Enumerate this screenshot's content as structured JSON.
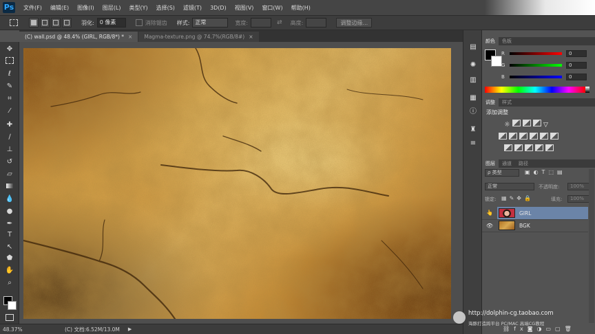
{
  "app": {
    "logo": "Ps"
  },
  "menu": [
    "文件(F)",
    "编辑(E)",
    "图像(I)",
    "图层(L)",
    "类型(Y)",
    "选择(S)",
    "滤镜(T)",
    "3D(D)",
    "视图(V)",
    "窗口(W)",
    "帮助(H)"
  ],
  "options": {
    "feather_label": "羽化:",
    "feather_value": "0 像素",
    "antialias_label": "消除锯齿",
    "style_label": "样式:",
    "style_value": "正常",
    "width_label": "宽度:",
    "height_label": "高度:",
    "refine_edge_button": "调整边缘..."
  },
  "tabs": [
    {
      "label": "(C) wall.psd @ 48.4% (GIRL, RGB/8*) *",
      "close": "×"
    },
    {
      "label": "Magma-texture.png @ 74.7%(RGB/8#)",
      "close": "×"
    }
  ],
  "status": {
    "zoom": "48.37%",
    "doc": "(C) 文档:6.52M/13.0M",
    "arrow": "▶"
  },
  "color_panel": {
    "tabs": [
      "颜色",
      "色板"
    ],
    "channels": [
      {
        "name": "R",
        "value": "0"
      },
      {
        "name": "G",
        "value": "0"
      },
      {
        "name": "B",
        "value": "0"
      }
    ]
  },
  "adjust_panel": {
    "tabs": [
      "调整",
      "样式"
    ],
    "title": "添加调整"
  },
  "layers_panel": {
    "tabs": [
      "图层",
      "通道",
      "路径"
    ],
    "filter_value": "ρ 类型",
    "blend_mode": "正常",
    "opacity_label": "不透明度:",
    "opacity_value": "100%",
    "lock_label": "锁定:",
    "fill_label": "填充:",
    "fill_value": "100%",
    "layers": [
      {
        "name": "GIRL",
        "selected": true
      },
      {
        "name": "BGK",
        "selected": false
      }
    ]
  },
  "watermark": {
    "url": "http://dolphin-cg.taobao.com",
    "caption": "海豚打造跨平台 PC/MAC 高端CG教程"
  },
  "colors": {
    "accent_blue": "#2fa7ff",
    "selected_layer": "#6b84a8"
  }
}
